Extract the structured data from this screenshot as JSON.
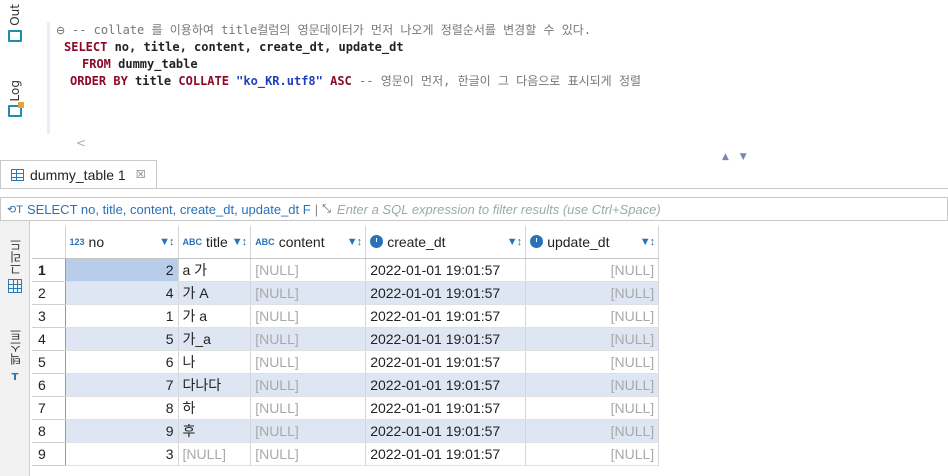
{
  "side_tabs": {
    "out": "Out",
    "log": "Log"
  },
  "editor": {
    "fold_marker": "⊖",
    "line1_comment": "-- collate 를 이용하여 title컬럼의 영문데이터가 먼저 나오게 정렬순서를 변경할 수 있다.",
    "line2": {
      "kw": "SELECT",
      "rest": " no, title, content, create_dt, update_dt"
    },
    "line3": {
      "kw": "FROM",
      "rest": " dummy_table"
    },
    "line4": {
      "kw1": "ORDER BY",
      "col": " title ",
      "kw2": "COLLATE",
      "str": " \"ko_KR.utf8\" ",
      "kw3": "ASC",
      "comment": " -- 영문이 먼저, 한글이 그 다음으로 표시되게 정렬"
    },
    "scroll_left": "<"
  },
  "results": {
    "tab_label": "dummy_table 1",
    "tab_close": "☒",
    "nav_arrows": "▲ ▼",
    "filter_sql": "SELECT no, title, content, create_dt, update_dt F",
    "filter_sep": "|",
    "filter_placeholder": "Enter a SQL expression to filter results (use Ctrl+Space)",
    "side": {
      "grid": "그리드",
      "text": "텍스트",
      "text_icon": "ᴛ"
    },
    "columns": [
      {
        "badge": "123",
        "name": "no"
      },
      {
        "badge": "ABC",
        "name": "title"
      },
      {
        "badge": "ABC",
        "name": "content"
      },
      {
        "badge": "",
        "name": "create_dt"
      },
      {
        "badge": "",
        "name": "update_dt"
      }
    ],
    "sort_glyph": "▼↕",
    "rows": [
      {
        "rownum": "1",
        "no": "2",
        "title": "a 가",
        "content": "[NULL]",
        "create_dt": "2022-01-01 19:01:57",
        "update_dt": "[NULL]"
      },
      {
        "rownum": "2",
        "no": "4",
        "title": "가 A",
        "content": "[NULL]",
        "create_dt": "2022-01-01 19:01:57",
        "update_dt": "[NULL]"
      },
      {
        "rownum": "3",
        "no": "1",
        "title": "가 a",
        "content": "[NULL]",
        "create_dt": "2022-01-01 19:01:57",
        "update_dt": "[NULL]"
      },
      {
        "rownum": "4",
        "no": "5",
        "title": "가_a",
        "content": "[NULL]",
        "create_dt": "2022-01-01 19:01:57",
        "update_dt": "[NULL]"
      },
      {
        "rownum": "5",
        "no": "6",
        "title": "나",
        "content": "[NULL]",
        "create_dt": "2022-01-01 19:01:57",
        "update_dt": "[NULL]"
      },
      {
        "rownum": "6",
        "no": "7",
        "title": "다나다",
        "content": "[NULL]",
        "create_dt": "2022-01-01 19:01:57",
        "update_dt": "[NULL]"
      },
      {
        "rownum": "7",
        "no": "8",
        "title": "하",
        "content": "[NULL]",
        "create_dt": "2022-01-01 19:01:57",
        "update_dt": "[NULL]"
      },
      {
        "rownum": "8",
        "no": "9",
        "title": "후",
        "content": "[NULL]",
        "create_dt": "2022-01-01 19:01:57",
        "update_dt": "[NULL]"
      },
      {
        "rownum": "9",
        "no": "3",
        "title": "[NULL]",
        "content": "[NULL]",
        "create_dt": "2022-01-01 19:01:57",
        "update_dt": "[NULL]"
      }
    ]
  }
}
